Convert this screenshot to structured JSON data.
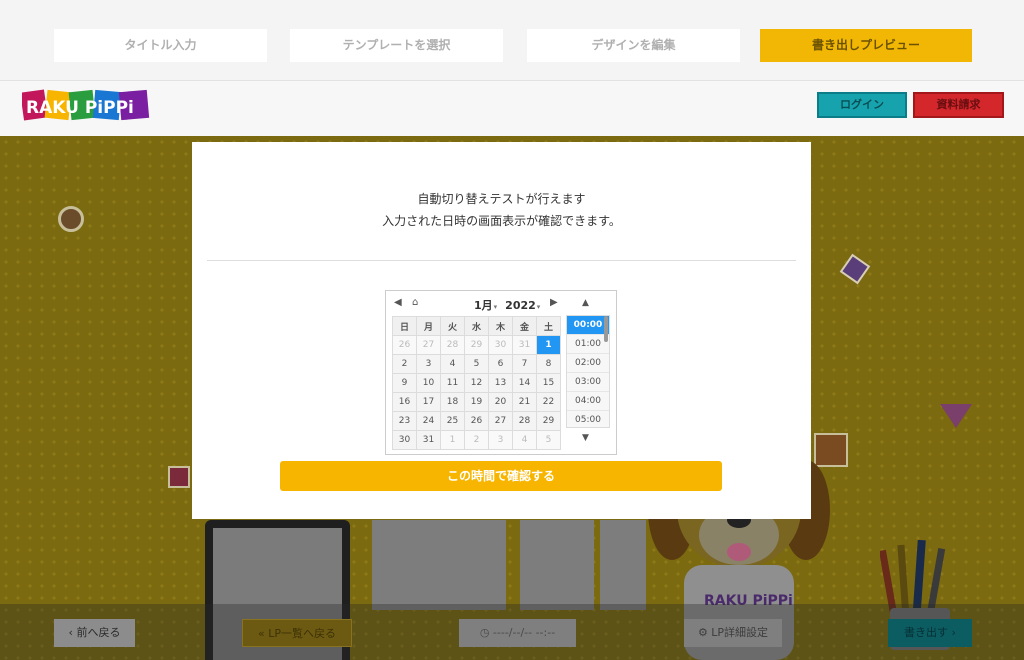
{
  "steps": [
    "タイトル入力",
    "テンプレートを選択",
    "デザインを編集",
    "書き出しプレビュー"
  ],
  "header": {
    "logo_text": "RAKU PiPPi",
    "login": "ログイン",
    "request": "資料請求"
  },
  "bottom_bar": {
    "prev": "前へ戻る",
    "back_to_list": "LP一覧へ戻る",
    "datetime_placeholder": "----/--/-- --:--",
    "lp_settings": "LP詳細設定",
    "export": "書き出す"
  },
  "modal": {
    "message_line1": "自動切り替えテストが行えます",
    "message_line2": "入力された日時の画面表示が確認できます。",
    "month": "1月",
    "year": "2022",
    "weekdays": [
      "日",
      "月",
      "火",
      "水",
      "木",
      "金",
      "土"
    ],
    "weeks": [
      [
        "26",
        "27",
        "28",
        "29",
        "30",
        "31",
        "1"
      ],
      [
        "2",
        "3",
        "4",
        "5",
        "6",
        "7",
        "8"
      ],
      [
        "9",
        "10",
        "11",
        "12",
        "13",
        "14",
        "15"
      ],
      [
        "16",
        "17",
        "18",
        "19",
        "20",
        "21",
        "22"
      ],
      [
        "23",
        "24",
        "25",
        "26",
        "27",
        "28",
        "29"
      ],
      [
        "30",
        "31",
        "1",
        "2",
        "3",
        "4",
        "5"
      ]
    ],
    "times": [
      "00:00",
      "01:00",
      "02:00",
      "03:00",
      "04:00",
      "05:00"
    ],
    "selected_time": "00:00",
    "selected_day": "1",
    "confirm_button": "この時間で確認する"
  },
  "colors": {
    "accent": "#f7b500",
    "selected": "#2196f3"
  }
}
